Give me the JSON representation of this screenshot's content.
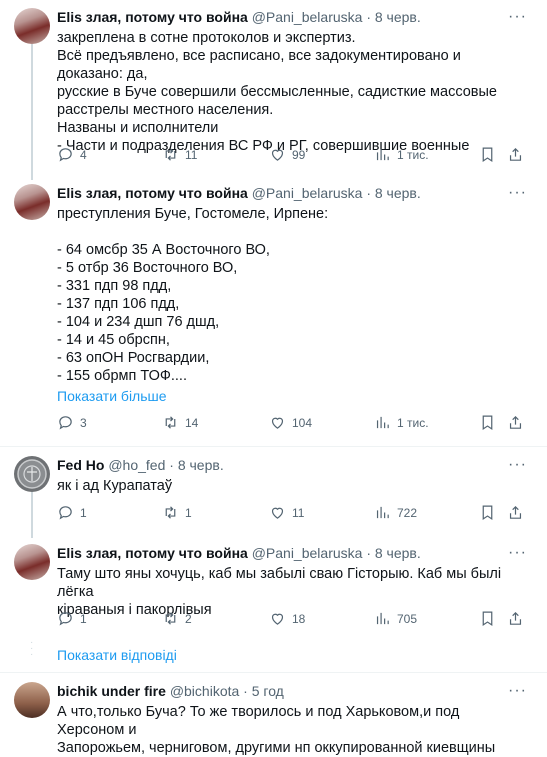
{
  "tweets": [
    {
      "author": "Elis злая, потому что война",
      "handle": "@Pani_belaruska",
      "date": "· 8 черв.",
      "text": "закреплена в сотне протоколов и экспертиз.\nВсё предъявлено, все расписано, все задокументировано и доказано: да,\nрусские в Буче совершили бессмысленные, садисткие массовые\nрасстрелы местного населения.\nНазваны и исполнители\n- Части и подразделения ВС РФ и РГ, совершившие военные",
      "stats": {
        "replies": "4",
        "retweets": "11",
        "likes": "99",
        "views": "1 тис."
      }
    },
    {
      "author": "Elis злая, потому что война",
      "handle": "@Pani_belaruska",
      "date": "· 8 черв.",
      "text": "преступления Буче, Гостомеле, Ирпене:\n\n- 64 омсбр 35 А Восточного ВО,\n- 5 отбр 36 Восточного ВО,\n- 331 пдп 98 пдд,\n- 137 пдп 106 пдд,\n- 104 и 234 дшп 76 дшд,\n- 14 и 45 обрспн,\n- 63 опОН Росгвардии,\n- 155 обрмп ТОФ....",
      "show_more": "Показати більше",
      "stats": {
        "replies": "3",
        "retweets": "14",
        "likes": "104",
        "views": "1 тис."
      }
    },
    {
      "author": "Fed Ho",
      "handle": "@ho_fed",
      "date": "· 8 черв.",
      "text": "як і ад Курапатаў",
      "stats": {
        "replies": "1",
        "retweets": "1",
        "likes": "11",
        "views": "722"
      }
    },
    {
      "author": "Elis злая, потому что война",
      "handle": "@Pani_belaruska",
      "date": "· 8 черв.",
      "text": "Таму што яны хочуць, каб мы забылі сваю Гісторыю. Каб мы былі лёгка\nкіраваныя і пакорлівыя",
      "stats": {
        "replies": "1",
        "retweets": "2",
        "likes": "18",
        "views": "705"
      }
    },
    {
      "author": "bichik under fire",
      "handle": "@bichikota",
      "date": "· 5 год",
      "text": "А что,только Буча? То же творилось и под Харьковом,и под Херсоном и\nЗапорожьем, черниговом, другими нп оккупированной киевщины"
    }
  ],
  "show_replies_label": "Показати відповіді",
  "more_glyph": "···",
  "colors": {
    "accent": "#1d9bf0",
    "text": "#0f1419",
    "muted": "#536471",
    "line": "#cfd9de"
  }
}
